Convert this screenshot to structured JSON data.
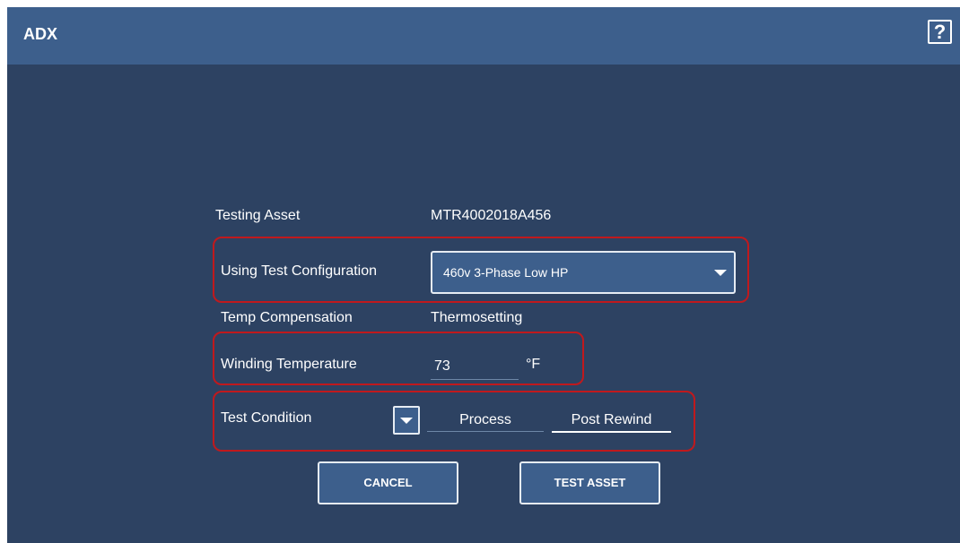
{
  "header": {
    "title": "ADX",
    "help_label": "?"
  },
  "form": {
    "testing_asset": {
      "label": "Testing Asset",
      "value": "MTR4002018A456"
    },
    "test_configuration": {
      "label": "Using Test Configuration",
      "selected": "460v 3-Phase Low HP"
    },
    "temp_compensation": {
      "label": "Temp Compensation",
      "value": "Thermosetting"
    },
    "winding_temperature": {
      "label": "Winding Temperature",
      "value": "73",
      "unit": "°F"
    },
    "test_condition": {
      "label": "Test Condition",
      "options": [
        "Process",
        "Post Rewind"
      ],
      "selected": "Post Rewind"
    }
  },
  "buttons": {
    "cancel": "CANCEL",
    "test_asset": "TEST ASSET"
  },
  "colors": {
    "background": "#2d4262",
    "header": "#3d5f8c",
    "highlight_border": "#c0191d",
    "text": "#ffffff"
  }
}
